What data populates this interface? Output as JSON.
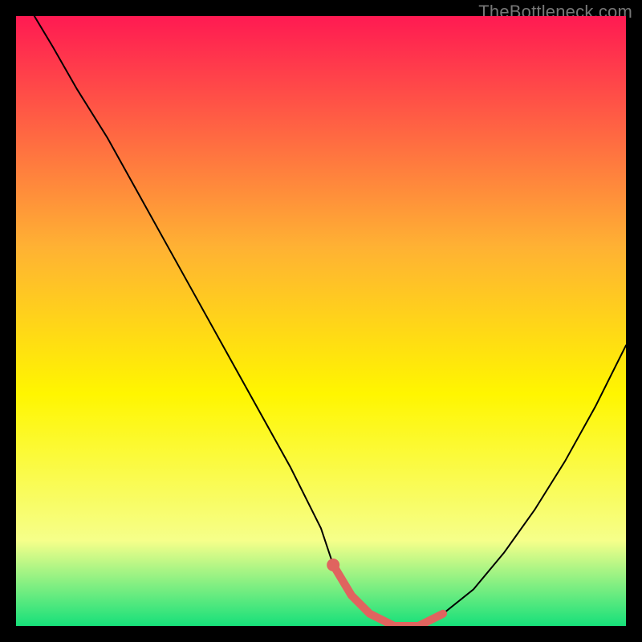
{
  "attribution": "TheBottleneck.com",
  "chart_data": {
    "type": "line",
    "title": "",
    "xlabel": "",
    "ylabel": "",
    "xlim": [
      0,
      100
    ],
    "ylim": [
      0,
      100
    ],
    "grid": false,
    "legend": false,
    "background_gradient": {
      "top": "#ff1a52",
      "upper_mid": "#ffb233",
      "mid": "#fff600",
      "lower_mid": "#f6ff8a",
      "bottom": "#16e07a"
    },
    "series": [
      {
        "name": "bottleneck-curve",
        "color": "#000000",
        "stroke_width": 2,
        "x": [
          3,
          6,
          10,
          15,
          20,
          25,
          30,
          35,
          40,
          45,
          50,
          52,
          55,
          58,
          62,
          66,
          70,
          75,
          80,
          85,
          90,
          95,
          100
        ],
        "y": [
          100,
          95,
          88,
          80,
          71,
          62,
          53,
          44,
          35,
          26,
          16,
          10,
          5,
          2,
          0,
          0,
          2,
          6,
          12,
          19,
          27,
          36,
          46
        ]
      },
      {
        "name": "optimal-zone-highlight",
        "color": "#e0645f",
        "stroke_width": 10,
        "x": [
          52,
          55,
          58,
          62,
          66,
          70
        ],
        "y": [
          10,
          5,
          2,
          0,
          0,
          2
        ]
      }
    ],
    "markers": [
      {
        "x": 52,
        "y": 10,
        "r": 8,
        "color": "#e0645f"
      }
    ]
  }
}
